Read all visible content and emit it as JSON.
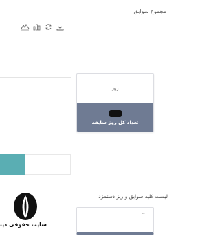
{
  "header": {
    "title": "مجموع سوابق"
  },
  "toolbar": {
    "icons": [
      "download-icon",
      "bar-chart-icon",
      "refresh-icon",
      "line-chart-icon"
    ]
  },
  "summary_card": {
    "unit": "روز",
    "label": "تعداد کل روز سابقه",
    "footer_color": "#6f7b93"
  },
  "list_section": {
    "title": "لیست کلیه سوابق و ریز دستمزد",
    "placeholder": ".."
  },
  "chart": {
    "bar_color": "#5aaeb3"
  },
  "watermark": {
    "text": "سایت حقوقی دینا"
  }
}
